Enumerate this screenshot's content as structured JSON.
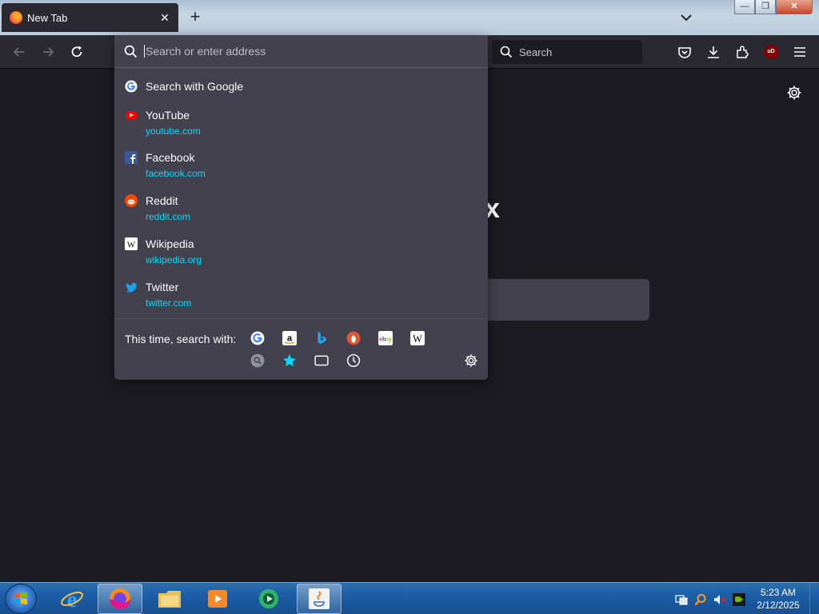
{
  "browser": {
    "tab": {
      "title": "New Tab",
      "close": "✕"
    },
    "new_tab": "+",
    "window_controls": {
      "minimize": "—",
      "maximize": "❐",
      "close": "✕"
    },
    "search_placeholder": "Search",
    "ublock_label": "uD"
  },
  "urlbar": {
    "placeholder": "Search or enter address",
    "search_suggestion": "Search with Google",
    "sites": [
      {
        "title": "YouTube",
        "url": "youtube.com",
        "icon": "youtube-icon"
      },
      {
        "title": "Facebook",
        "url": "facebook.com",
        "icon": "facebook-icon"
      },
      {
        "title": "Reddit",
        "url": "reddit.com",
        "icon": "reddit-icon"
      },
      {
        "title": "Wikipedia",
        "url": "wikipedia.org",
        "icon": "wikipedia-icon"
      },
      {
        "title": "Twitter",
        "url": "twitter.com",
        "icon": "twitter-icon"
      }
    ],
    "oneoff_label": "This time, search with:",
    "engines": [
      "google-icon",
      "amazon-icon",
      "bing-icon",
      "duckduckgo-icon",
      "ebay-icon",
      "wikipedia-icon"
    ],
    "modes": [
      "search-engines-icon",
      "bookmarks-icon",
      "tabs-icon",
      "history-icon"
    ]
  },
  "page": {
    "partial_logo_text": "x"
  },
  "taskbar": {
    "apps": [
      "internet-explorer-icon",
      "firefox-icon",
      "file-explorer-icon",
      "media-player-icon",
      "app-icon",
      "java-icon"
    ],
    "clock_time": "5:23 AM",
    "clock_date": "2/12/2025"
  },
  "colors": {
    "accent": "#00ddff",
    "panel": "#42414d",
    "toolbar": "#2b2a33",
    "page": "#1c1b22"
  }
}
